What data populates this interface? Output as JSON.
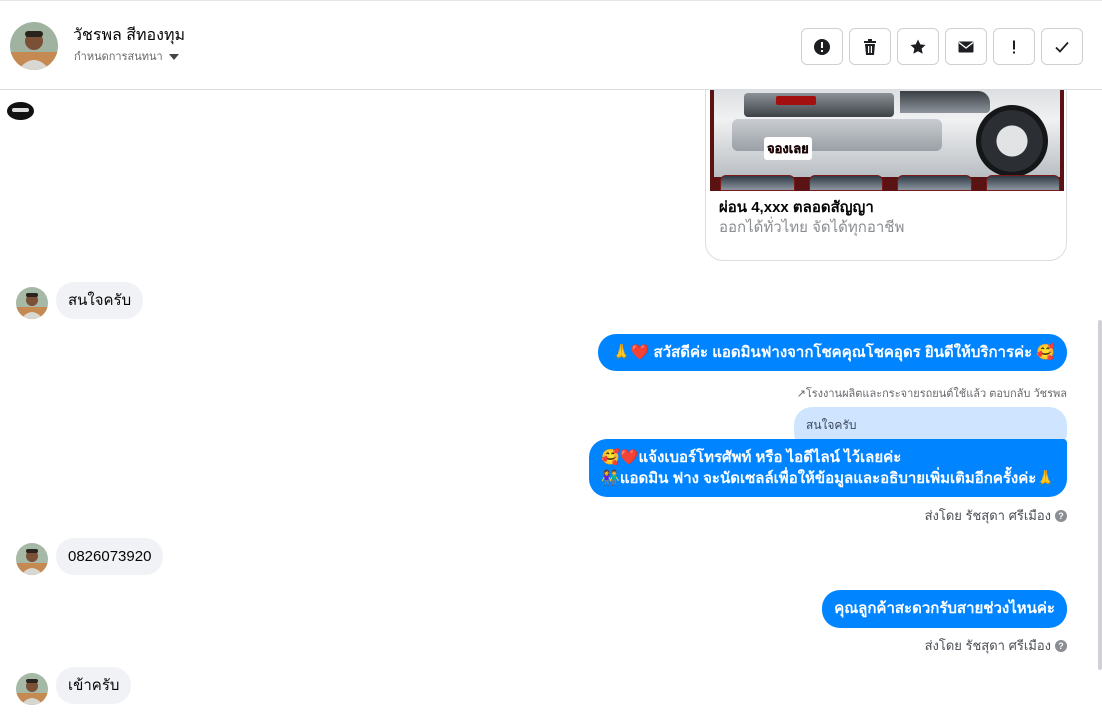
{
  "header": {
    "contact_name": "วัชรพล สีทองทุม",
    "assign_label": "กำหนดการสนทนา",
    "actions": [
      {
        "name": "report-icon",
        "label": "!"
      },
      {
        "name": "trash-icon",
        "label": ""
      },
      {
        "name": "star-icon",
        "label": ""
      },
      {
        "name": "mail-icon",
        "label": ""
      },
      {
        "name": "exclamation-icon",
        "label": "!"
      },
      {
        "name": "check-icon",
        "label": ""
      }
    ]
  },
  "ad_card": {
    "image_tag": "จองเลย",
    "title": "ผ่อน 4,xxx ตลอดสัญญา",
    "subtitle": "ออกได้ทั่วไทย จัดได้ทุกอาชีพ"
  },
  "messages": {
    "in_1": "สนใจครับ",
    "out_1_text": "สวัสดีค่ะ แอดมินฟางจากโชคคุณโชคอุดร ยินดีให้บริการค่ะ",
    "out_1_emoji_left": "🙏❤️",
    "out_1_emoji_right": "🥰",
    "reply_meta": "↗โรงงานผลิตและกระจายรถยนต์ใช้แล้ว ตอบกลับ วัชรพล",
    "reply_quote": "สนใจครับ",
    "out_2_line1": "🥰❤️แจ้งเบอร์โทรศัพท์ หรือ ไอดีไลน์  ไว้เลยค่ะ",
    "out_2_line2": "👫แอดมิน ฟาง จะนัดเซลล์เพื่อให้ข้อมูลและอธิบายเพิ่มเติมอีกครั้งค่ะ🙏",
    "sent_by_1": "ส่งโดย รัชสุดา ศรีเมือง",
    "in_2": "0826073920",
    "out_3": "คุณลูกค้าสะดวกรับสายช่วงไหนค่ะ",
    "sent_by_2": "ส่งโดย รัชสุดา ศรีเมือง",
    "in_3": "เข้าครับ"
  },
  "colors": {
    "accent": "#0084ff",
    "incoming_bubble": "#f0f2f5",
    "quote_bubble": "#cfe5ff"
  }
}
